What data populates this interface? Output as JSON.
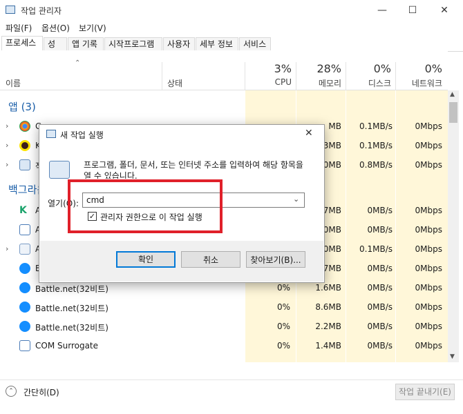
{
  "window": {
    "title": "작업 관리자",
    "minimize": "—",
    "maximize": "☐",
    "close": "✕"
  },
  "menu": [
    "파일(F)",
    "옵션(O)",
    "보기(V)"
  ],
  "tabs": [
    "프로세스",
    "성능",
    "앱 기록",
    "시작프로그램",
    "사용자",
    "세부 정보",
    "서비스"
  ],
  "columns": {
    "name": "이름",
    "status": "상태",
    "cpu": {
      "pct": "3%",
      "label": "CPU"
    },
    "memory": {
      "pct": "28%",
      "label": "메모리"
    },
    "disk": {
      "pct": "0%",
      "label": "디스크"
    },
    "network": {
      "pct": "0%",
      "label": "네트워크"
    }
  },
  "groups": {
    "apps": "앱 (3)",
    "background": "백그라운드"
  },
  "rows": [
    {
      "name": "G",
      "cpu": "",
      "mem": "MB",
      "disk": "0.1MB/s",
      "net": "0Mbps"
    },
    {
      "name": "K",
      "cpu": "",
      "mem": "3MB",
      "disk": "0.1MB/s",
      "net": "0Mbps"
    },
    {
      "name": "작",
      "cpu": "",
      "mem": "0MB",
      "disk": "0.8MB/s",
      "net": "0Mbps"
    },
    {
      "name": "A",
      "cpu": "",
      "mem": "7MB",
      "disk": "0MB/s",
      "net": "0Mbps"
    },
    {
      "name": "A",
      "cpu": "",
      "mem": "0MB",
      "disk": "0MB/s",
      "net": "0Mbps"
    },
    {
      "name": "A",
      "cpu": "",
      "mem": "0MB",
      "disk": "0.1MB/s",
      "net": "0Mbps"
    },
    {
      "name": "B",
      "cpu": "",
      "mem": "7MB",
      "disk": "0MB/s",
      "net": "0Mbps"
    },
    {
      "name": "Battle.net(32비트)",
      "cpu": "0%",
      "mem": "1.6MB",
      "disk": "0MB/s",
      "net": "0Mbps"
    },
    {
      "name": "Battle.net(32비트)",
      "cpu": "0%",
      "mem": "8.6MB",
      "disk": "0MB/s",
      "net": "0Mbps"
    },
    {
      "name": "Battle.net(32비트)",
      "cpu": "0%",
      "mem": "2.2MB",
      "disk": "0MB/s",
      "net": "0Mbps"
    },
    {
      "name": "COM Surrogate",
      "cpu": "0%",
      "mem": "1.4MB",
      "disk": "0MB/s",
      "net": "0Mbps"
    }
  ],
  "footer": {
    "collapse": "간단히(D)",
    "end_task": "작업 끝내기(E)"
  },
  "dialog": {
    "title": "새 작업 실행",
    "description": "프로그램, 폴더, 문서, 또는 인터넷 주소를 입력하여 해당 항목을 열 수 있습니다.",
    "open_label": "열기(O):",
    "open_value": "cmd",
    "admin_checkbox": "관리자 권한으로 이 작업 실행",
    "ok": "확인",
    "cancel": "취소",
    "browse": "찾아보기(B)...",
    "close": "✕"
  }
}
